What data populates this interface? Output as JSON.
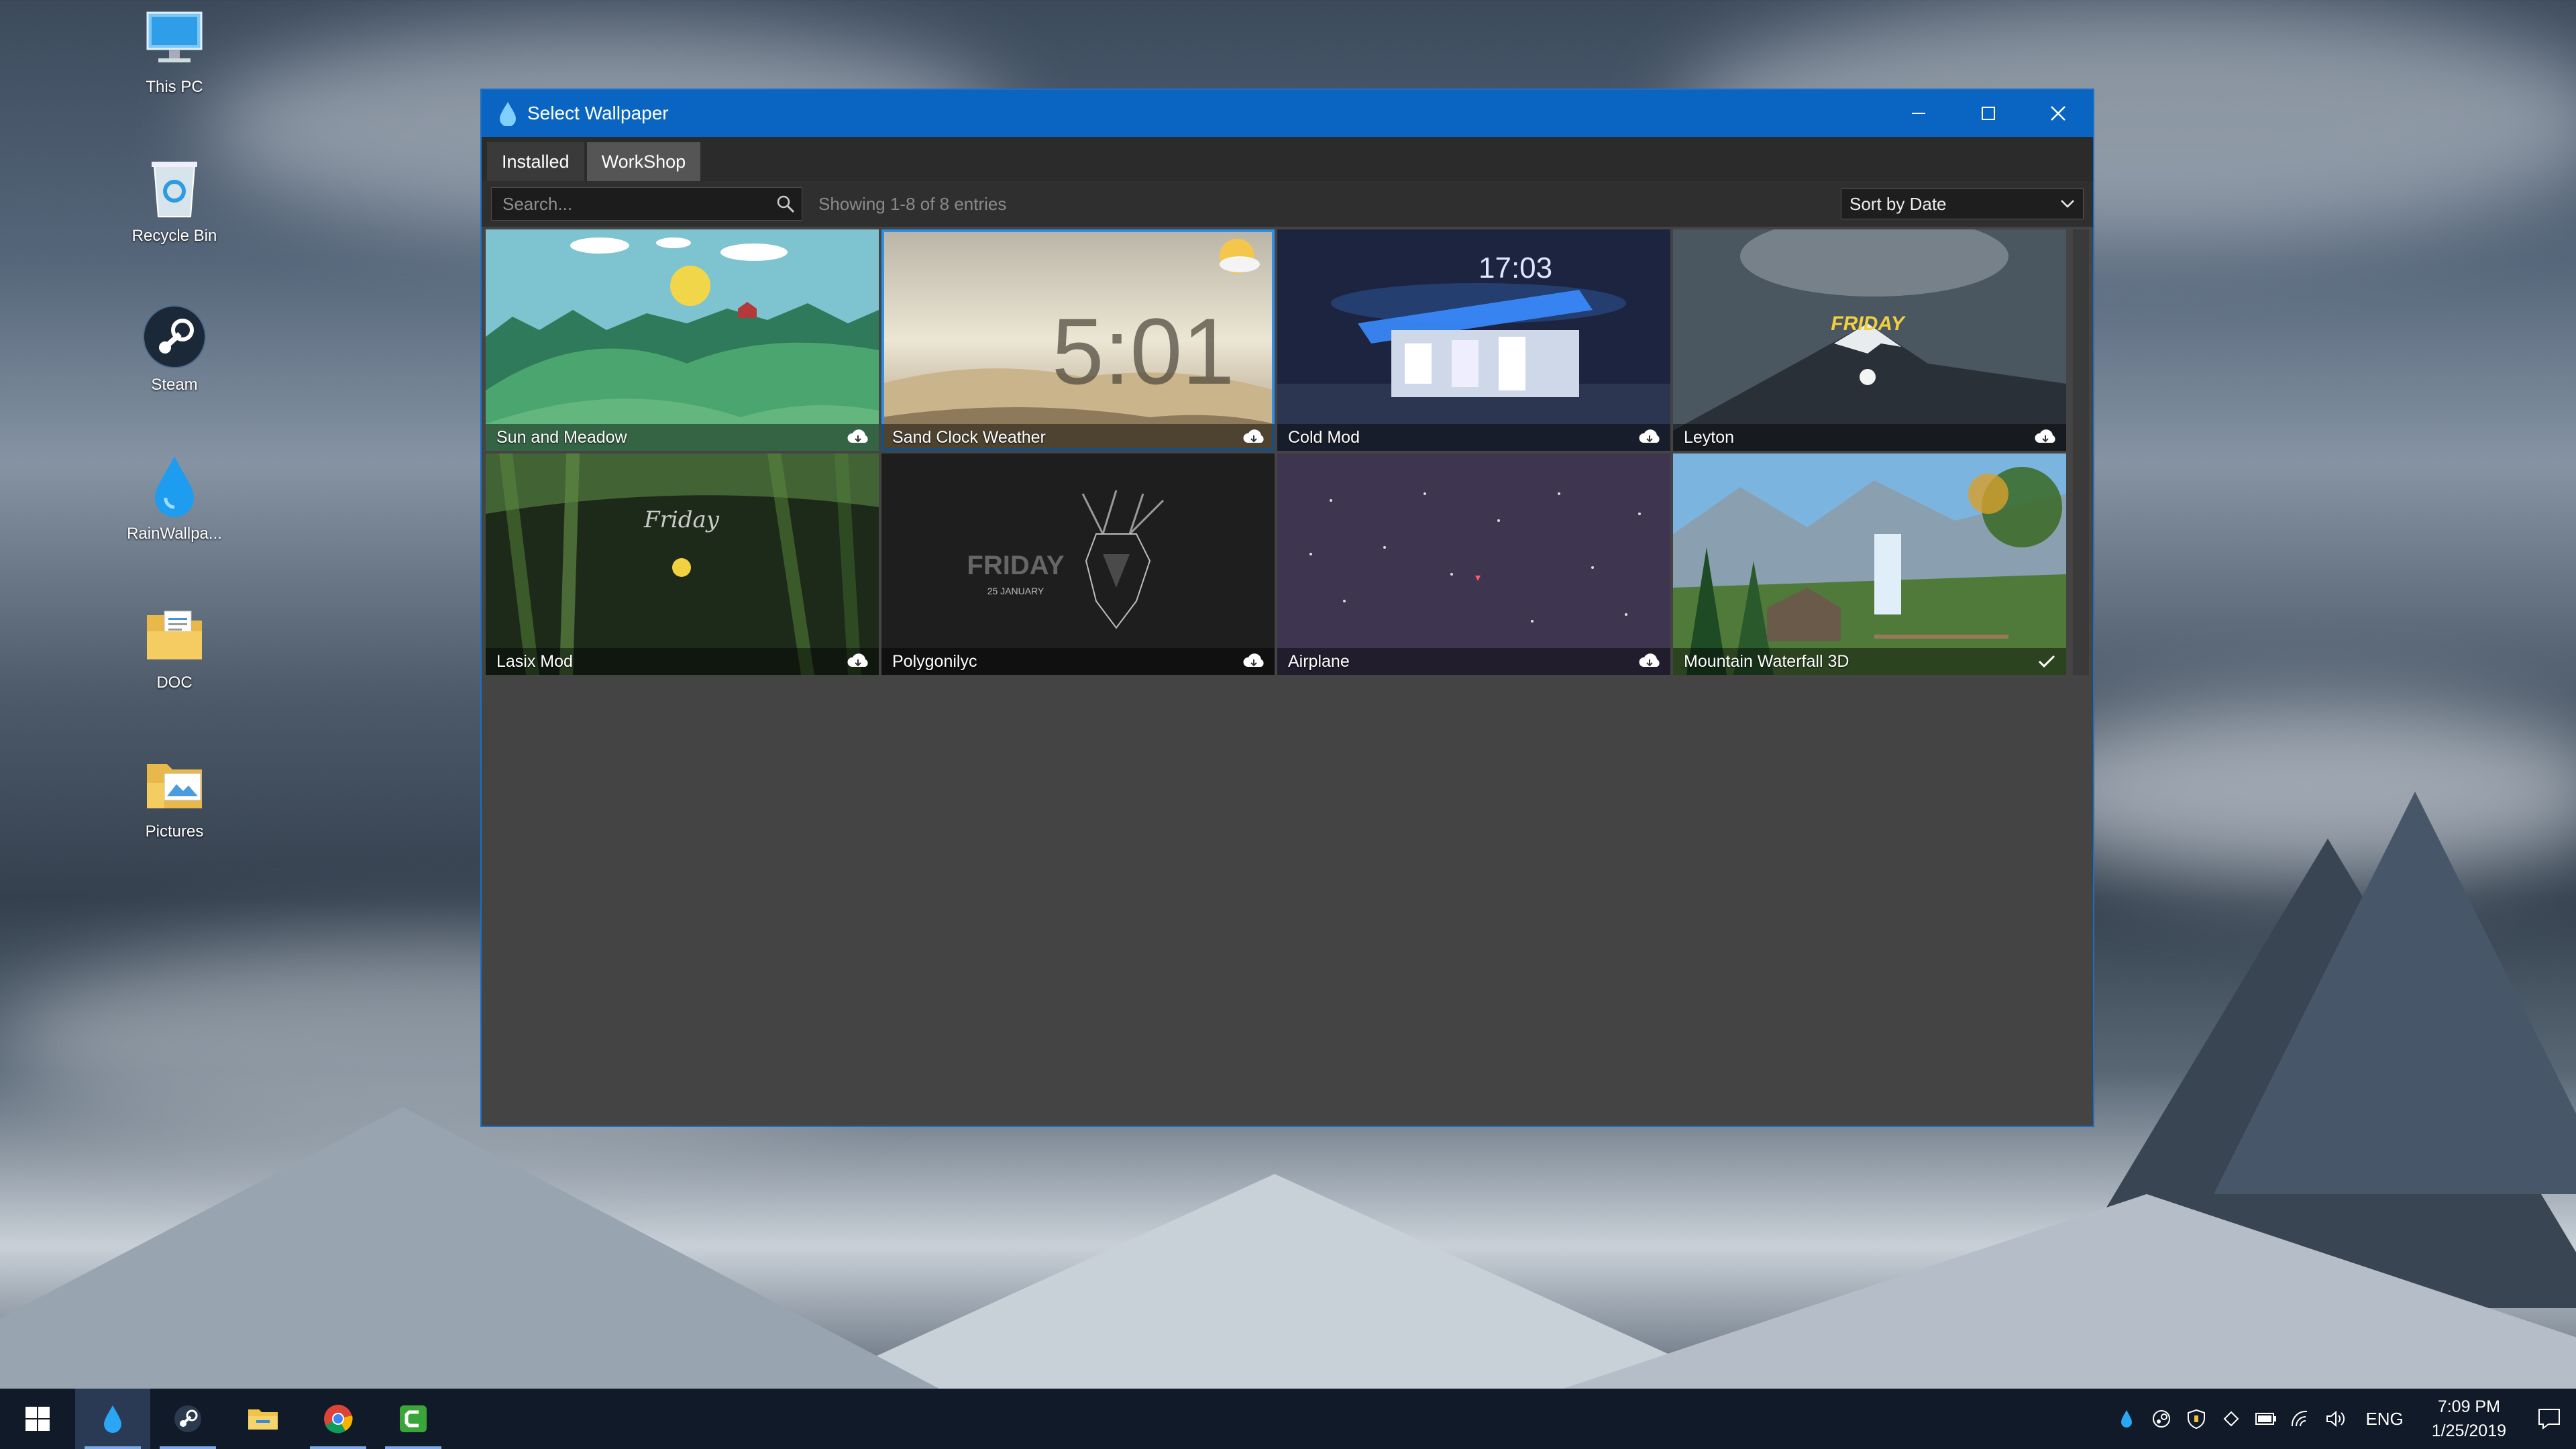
{
  "desktop": {
    "icons": [
      {
        "label": "This PC",
        "icon": "computer-icon"
      },
      {
        "label": "Recycle Bin",
        "icon": "recycle-bin-icon"
      },
      {
        "label": "Steam",
        "icon": "steam-icon"
      },
      {
        "label": "RainWallpa...",
        "icon": "raindrop-icon"
      },
      {
        "label": "DOC",
        "icon": "folder-icon"
      },
      {
        "label": "Pictures",
        "icon": "folder-icon"
      }
    ]
  },
  "window": {
    "title": "Select Wallpaper",
    "tabs": [
      {
        "label": "Installed",
        "active": false
      },
      {
        "label": "WorkShop",
        "active": true
      }
    ],
    "search": {
      "placeholder": "Search..."
    },
    "entries_text": "Showing 1-8 of 8 entries",
    "sort": {
      "selected": "Sort by Date"
    },
    "wallpapers": [
      {
        "name": "Sun and Meadow",
        "status": "cloud-download-icon"
      },
      {
        "name": "Sand Clock Weather",
        "status": "cloud-download-icon",
        "selected": true,
        "clock_text": "5:01"
      },
      {
        "name": "Cold Mod",
        "status": "cloud-download-icon",
        "clock_text": "17:03"
      },
      {
        "name": "Leyton",
        "status": "cloud-download-icon",
        "overlay_text": "FRIDAY"
      },
      {
        "name": "Lasix Mod",
        "status": "cloud-download-icon",
        "overlay_text": "Friday"
      },
      {
        "name": "Polygonilyc",
        "status": "cloud-download-icon",
        "overlay_text": "FRIDAY",
        "date_text": "25 JANUARY"
      },
      {
        "name": "Airplane",
        "status": "cloud-download-icon"
      },
      {
        "name": "Mountain Waterfall 3D",
        "status": "check-icon"
      }
    ]
  },
  "taskbar": {
    "apps": [
      "start-icon",
      "raindrop-icon",
      "steam-icon",
      "file-explorer-icon",
      "chrome-icon",
      "camtasia-icon"
    ],
    "tray_icons": [
      "raindrop-icon",
      "steam-icon",
      "security-icon",
      "dropbox-icon",
      "battery-icon",
      "wifi-icon",
      "volume-icon"
    ],
    "language": "ENG",
    "time": "7:09 PM",
    "date": "1/25/2019"
  },
  "colors": {
    "accent": "#0a64c2",
    "selection": "#2e8ee8",
    "window_bg": "#444444"
  }
}
